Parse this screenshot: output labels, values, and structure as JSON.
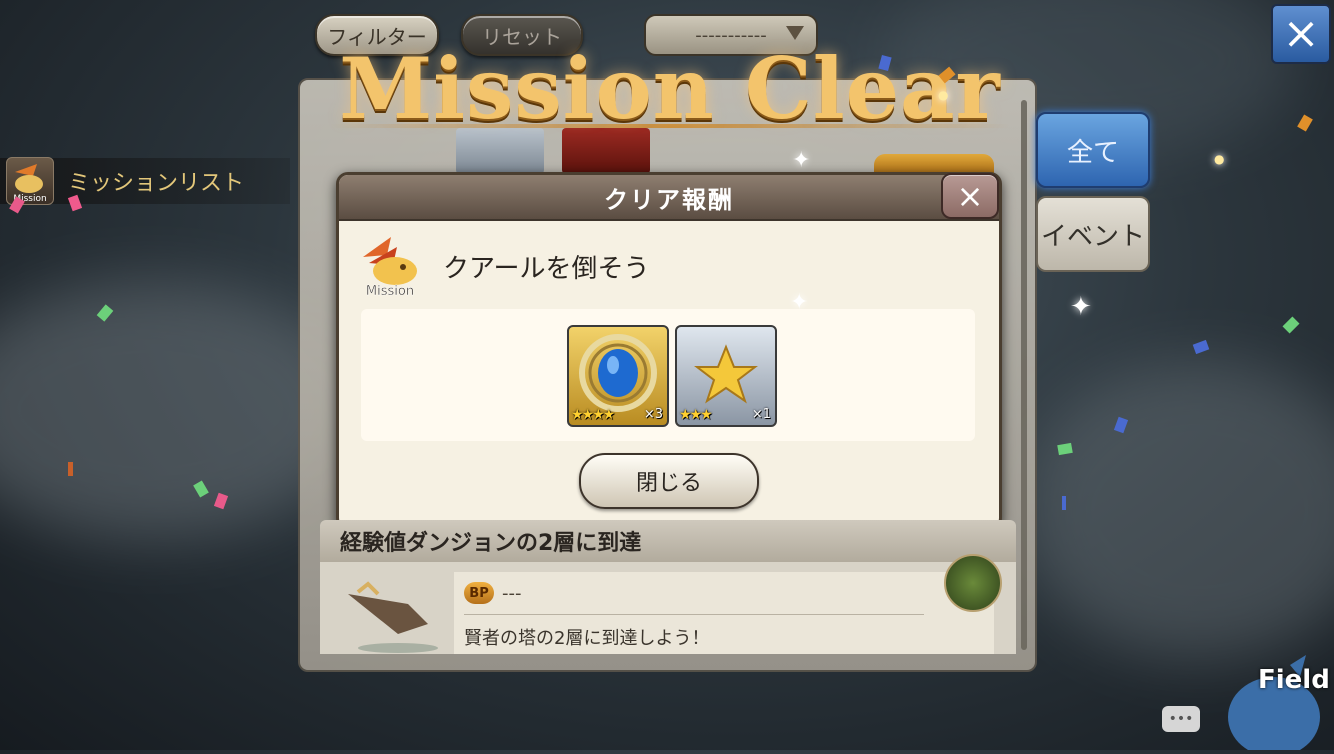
{
  "header": {
    "filter_label": "フィルター",
    "reset_label": "リセット",
    "dropdown_value": "-----------"
  },
  "close_icon": "×",
  "sidebar": {
    "mission_list_label": "ミッションリスト",
    "mission_icon_text": "Mission"
  },
  "banner": {
    "title": "Mission Clear"
  },
  "tabs": {
    "all_label": "全て",
    "event_label": "イベント"
  },
  "dialog": {
    "title": "クリア報酬",
    "close_icon": "×",
    "emblem_text": "Mission",
    "mission_name": "クアールを倒そう",
    "rewards": [
      {
        "icon": "blue-crystal-icon",
        "stars": "★★★★",
        "quantity": "×3"
      },
      {
        "icon": "gold-star-icon",
        "stars": "★★★",
        "quantity": "×1"
      }
    ],
    "close_button_label": "閉じる"
  },
  "background_mission": {
    "title": "経験値ダンジョンの2層に到達",
    "bp_badge": "BP",
    "bp_value": "---",
    "description": "賢者の塔の2層に到達しよう！"
  },
  "field": {
    "label": "Field"
  },
  "chat_icon_text": "•••",
  "colors": {
    "accent_blue": "#2e65b0",
    "title_gold": "#f3c46c",
    "dialog_bg": "#f6f1e3"
  }
}
